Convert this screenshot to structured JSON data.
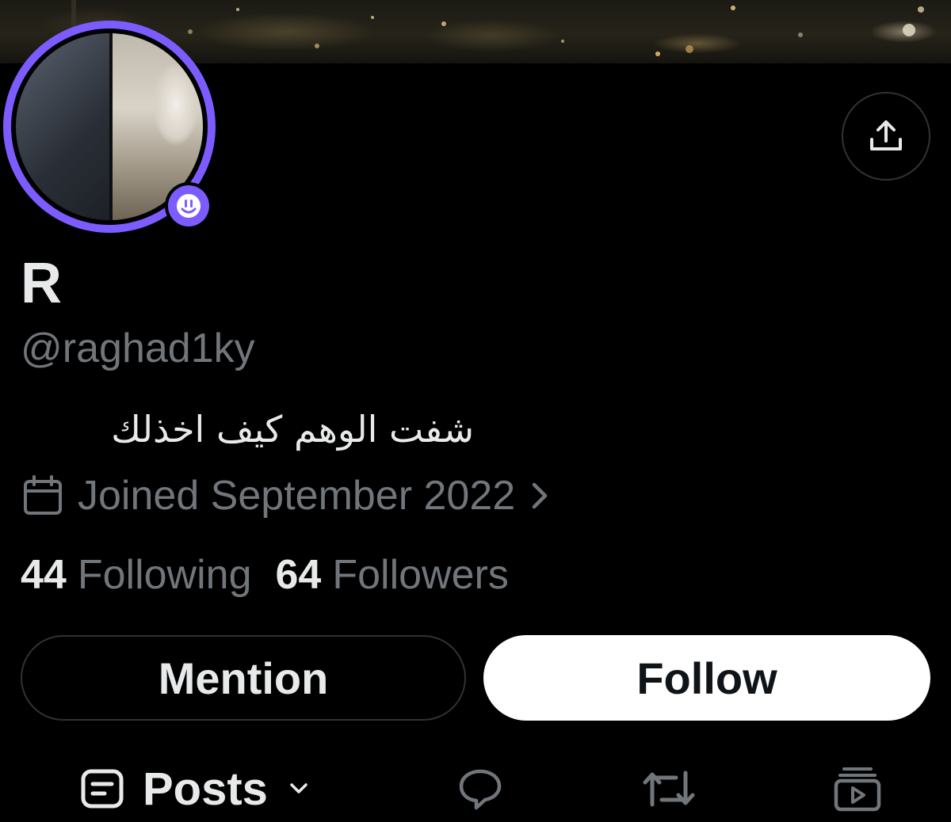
{
  "profile": {
    "display_name": "R",
    "handle": "@raghad1ky",
    "bio": "شفت الوهم كيف اخذلك",
    "joined": "Joined September 2022"
  },
  "stats": {
    "following_count": "44",
    "following_label": "Following",
    "followers_count": "64",
    "followers_label": "Followers"
  },
  "actions": {
    "mention_label": "Mention",
    "follow_label": "Follow"
  },
  "tabs": {
    "posts_label": "Posts"
  },
  "icons": {
    "share": "share-upload-icon",
    "calendar": "calendar-icon",
    "chevron": "chevron-right-icon",
    "avatar_badge": "spaces-badge-icon",
    "posts": "posts-icon",
    "dropdown": "chevron-down-icon",
    "replies": "reply-bubble-icon",
    "reposts": "repost-icon",
    "media": "media-play-icon"
  },
  "colors": {
    "background": "#000000",
    "accent_ring": "#7c5cff",
    "primary_text": "#e7e9ea",
    "secondary_text": "#71767b",
    "border": "#2f3336",
    "follow_bg": "#ffffff"
  }
}
